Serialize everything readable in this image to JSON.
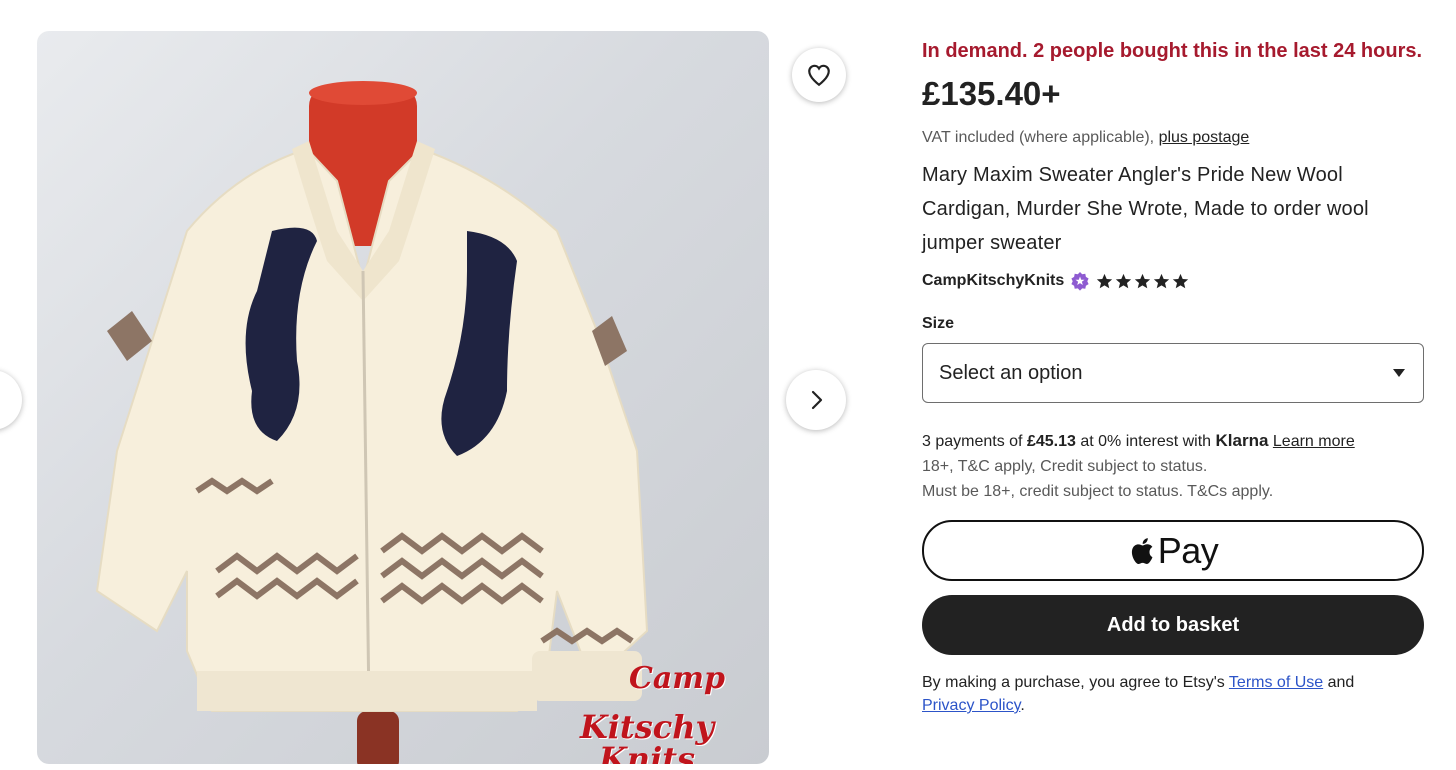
{
  "listing": {
    "demand_text": "In demand. 2 people bought this in the last 24 hours.",
    "price": "£135.40+",
    "vat_text": "VAT included (where applicable), ",
    "postage_link": "plus postage",
    "title": "Mary Maxim Sweater Angler's Pride New Wool Cardigan, Murder She Wrote, Made to order wool jumper sweater",
    "shop_name": "CampKitschyKnits",
    "rating_stars": 5
  },
  "image": {
    "watermark_line1": "Camp",
    "watermark_line2": "Kitschy Knits"
  },
  "size": {
    "label": "Size",
    "selected": "Select an option"
  },
  "klarna": {
    "prefix": "3 payments of ",
    "amount": "£45.13",
    "middle": " at 0% interest with ",
    "brand": "Klarna",
    "learn_more": "Learn more",
    "terms": "18+, T&C apply, Credit subject to status.",
    "notice": "Must be 18+, credit subject to status. T&Cs apply."
  },
  "buttons": {
    "apple_pay": "Pay",
    "add_to_basket": "Add to basket"
  },
  "legal": {
    "prefix": "By making a purchase, you agree to Etsy's ",
    "terms_link": "Terms of Use",
    "middle": " and",
    "privacy_link": "Privacy Policy",
    "suffix": "."
  },
  "colors": {
    "demand": "#a61a2e",
    "basket_button": "#222222",
    "link": "#2c54c8",
    "star_seller_badge": "#8e5bd1"
  },
  "icons": [
    "heart-icon",
    "chevron-right-icon",
    "chevron-left-icon",
    "star-seller-badge-icon",
    "star-icon",
    "apple-logo-icon",
    "caret-down-icon"
  ]
}
